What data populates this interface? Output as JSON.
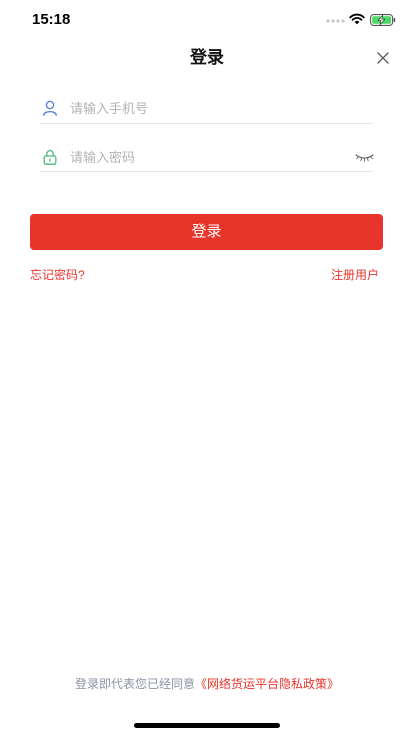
{
  "status_bar": {
    "time": "15:18",
    "icons": [
      "signal-icon",
      "wifi-icon",
      "battery-charging-icon"
    ]
  },
  "header": {
    "title": "登录",
    "close_icon": "close-icon"
  },
  "form": {
    "phone": {
      "icon": "user-icon",
      "placeholder": "请输入手机号",
      "value": ""
    },
    "password": {
      "icon": "lock-icon",
      "placeholder": "请输入密码",
      "value": "",
      "toggle_icon": "eye-closed-icon"
    },
    "submit_label": "登录"
  },
  "links": {
    "forgot": "忘记密码?",
    "register": "注册用户"
  },
  "footer": {
    "agree_text": "登录即代表您已经同意",
    "policy_link": "《网络货运平台隐私政策》"
  },
  "colors": {
    "accent": "#E8352B",
    "phone_icon": "#4A7FD6",
    "lock_icon": "#4CB87A",
    "battery": "#4CD964"
  }
}
